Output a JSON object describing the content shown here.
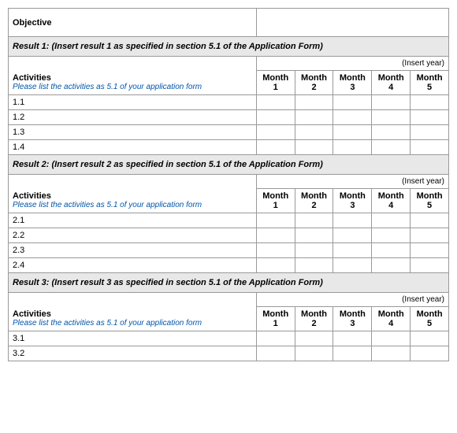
{
  "table": {
    "objective_label": "Objective",
    "months": [
      "Month 1",
      "Month 2",
      "Month 3",
      "Month 4",
      "Month 5"
    ],
    "insert_year": "(Insert year)",
    "activities_label": "Activities",
    "activities_sublabel": "Please list the activities as 5.1 of your application form",
    "results": [
      {
        "label": "Result 1:  (Insert result 1 as  specified in section 5.1 of the Application Form)",
        "rows": [
          "1.1",
          "1.2",
          "1.3",
          "1.4"
        ]
      },
      {
        "label": "Result 2:  (Insert result 2 as specified in section 5.1 of the Application Form)",
        "rows": [
          "2.1",
          "2.2",
          "2.3",
          "2.4"
        ]
      },
      {
        "label": "Result 3:  (Insert result 3 as specified in section 5.1 of the Application Form)",
        "rows": [
          "3.1",
          "3.2"
        ]
      }
    ]
  }
}
